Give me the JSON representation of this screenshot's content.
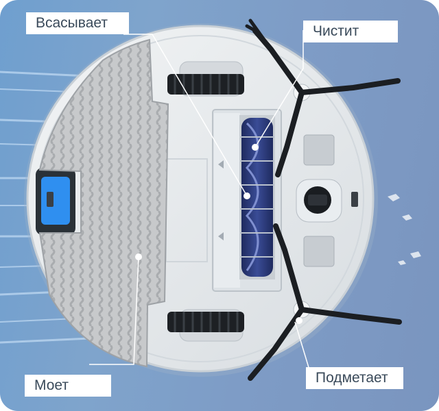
{
  "labels": {
    "suction": "Всасывает",
    "cleaning": "Чистит",
    "mopping": "Моет",
    "sweeping": "Подметает"
  },
  "colors": {
    "background": "#7e9fcb",
    "robot_body": "#e9ecee",
    "mop_pad": "#c9cbcc",
    "main_brush": "#2b3a78",
    "tank_accent": "#2f8ff0"
  },
  "icons": [
    "side-brush-icon",
    "caster-wheel-icon",
    "drive-wheel-icon",
    "main-brush-icon",
    "mop-pad-icon"
  ]
}
